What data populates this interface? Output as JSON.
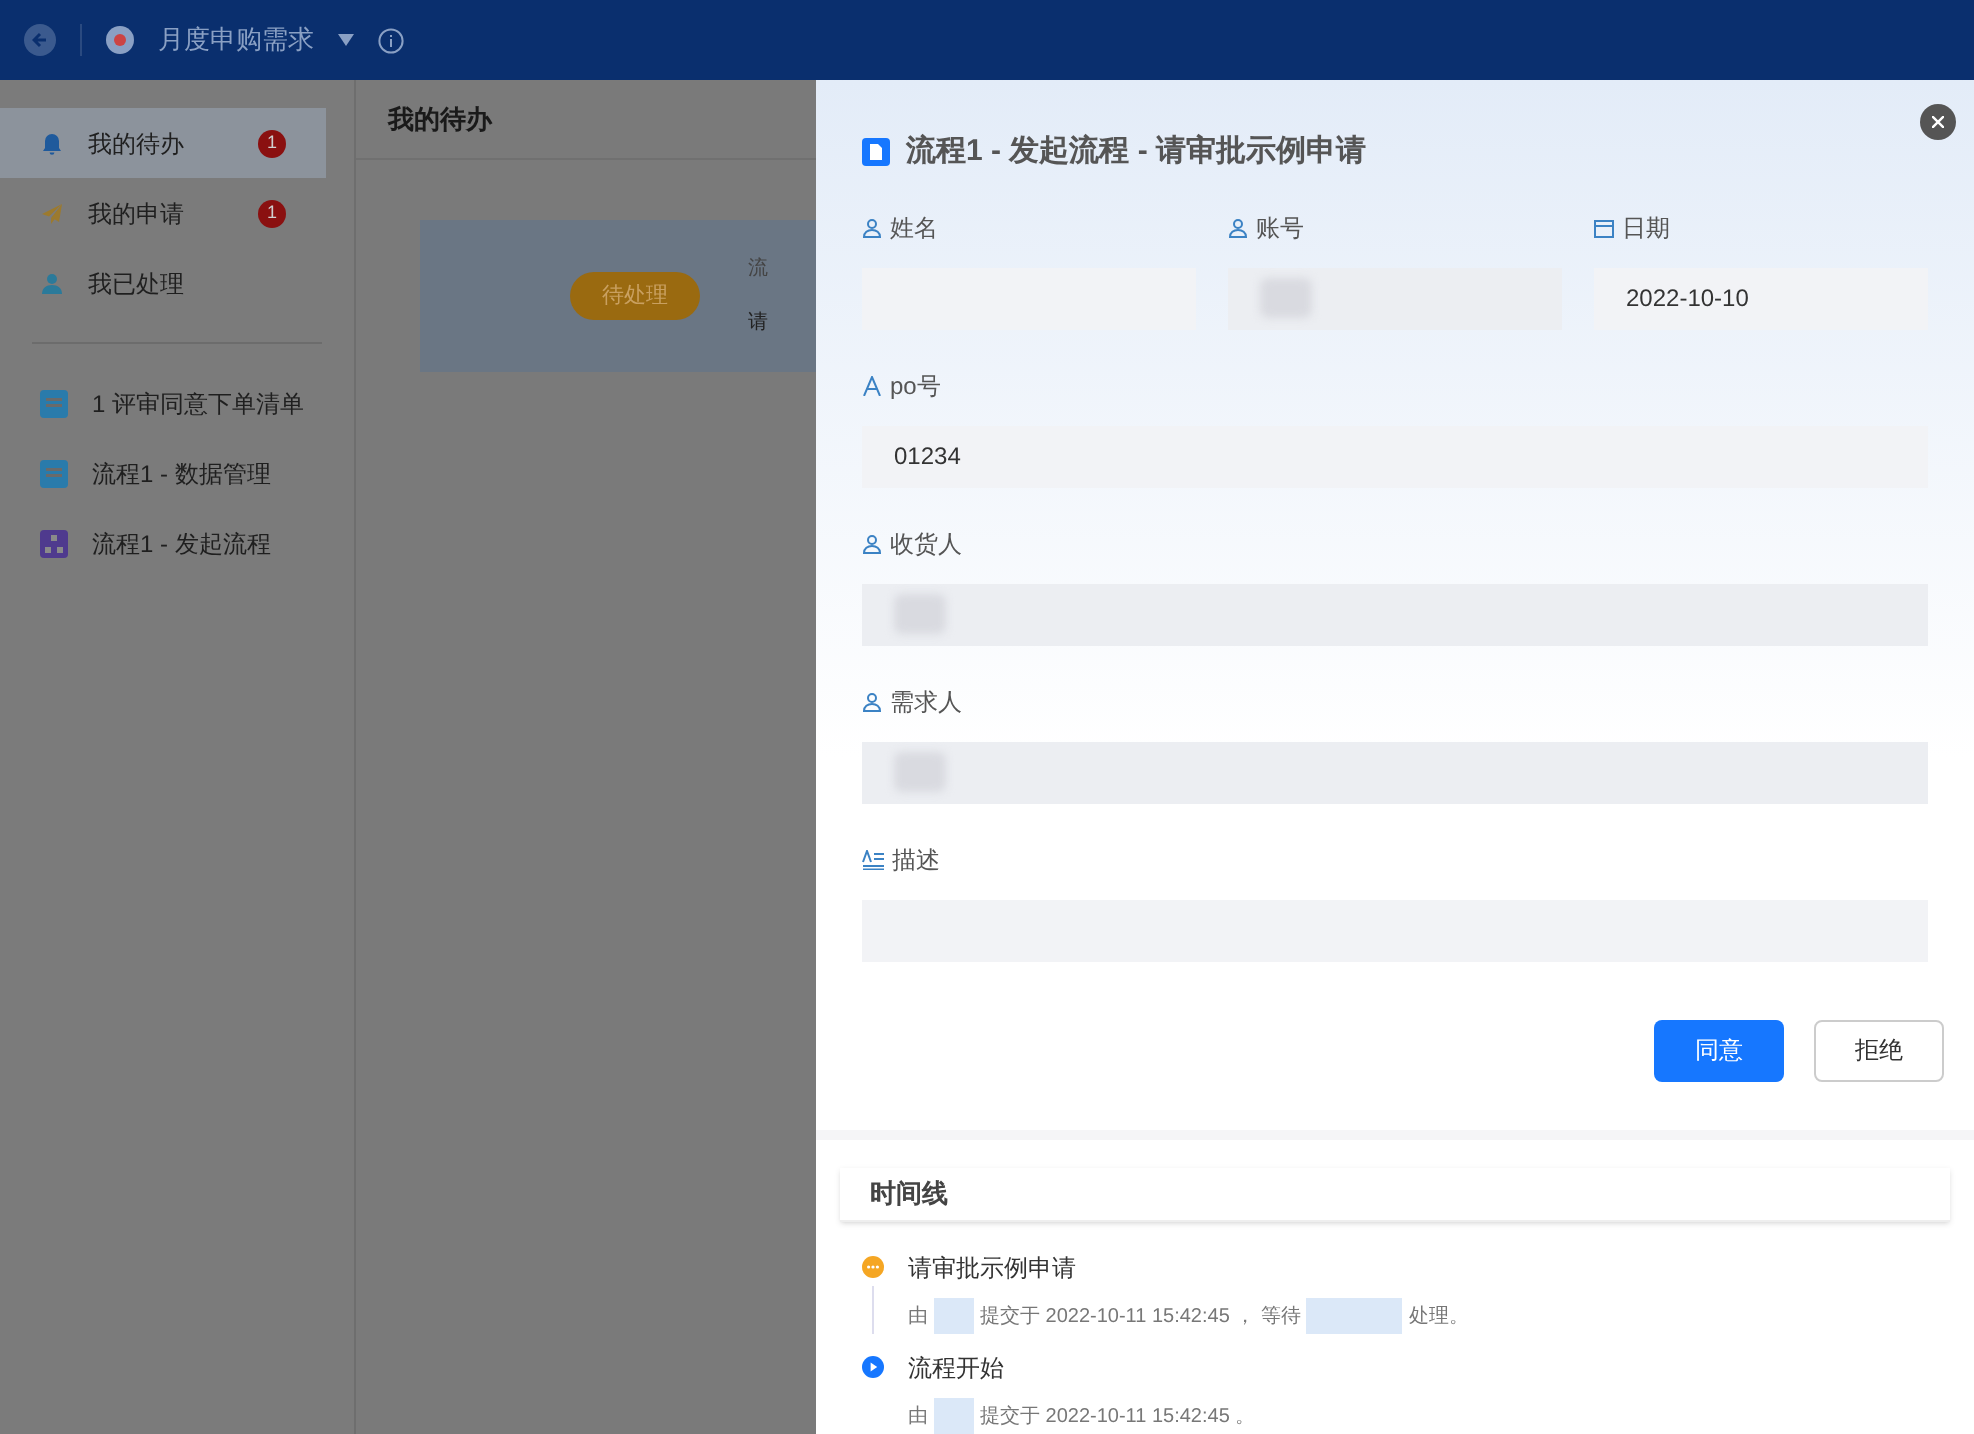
{
  "top_bar": {
    "app_title": "月度申购需求"
  },
  "sidebar": {
    "items": [
      {
        "label": "我的待办",
        "kind": "bell",
        "badge": "1",
        "selected": true
      },
      {
        "label": "我的申请",
        "kind": "send",
        "badge": "1",
        "selected": false
      },
      {
        "label": "我已处理",
        "kind": "user",
        "selected": false
      }
    ],
    "apps": [
      {
        "label": "1 评审同意下单清单",
        "kind": "doc"
      },
      {
        "label": "流程1 - 数据管理",
        "kind": "doc"
      },
      {
        "label": "流程1 - 发起流程",
        "kind": "flow"
      }
    ]
  },
  "main": {
    "title": "我的待办",
    "card": {
      "status": "待处理",
      "line_1": "流",
      "line_2": "请"
    }
  },
  "drawer": {
    "title": "流程1 - 发起流程 - 请审批示例申请",
    "field_rows": [
      [
        {
          "label": "姓名",
          "kind": "user",
          "blurred": false
        },
        {
          "label": "账号",
          "kind": "user",
          "blurred": true
        },
        {
          "label": "日期",
          "kind": "calendar",
          "value": "2022-10-10",
          "blurred": false
        }
      ],
      [
        {
          "label": "po号",
          "kind": "text",
          "value": "01234",
          "blurred": false
        }
      ],
      [
        {
          "label": "收货人",
          "kind": "user",
          "blurred": true
        }
      ],
      [
        {
          "label": "需求人",
          "kind": "user",
          "blurred": true
        }
      ],
      [
        {
          "label": "描述",
          "kind": "textarea",
          "blurred": false
        }
      ]
    ],
    "buttons": [
      {
        "label": "同意",
        "kind": "primary"
      },
      {
        "label": "拒绝",
        "kind": "default"
      }
    ],
    "timeline": {
      "title": "时间线",
      "events": [
        {
          "title": "请审批示例申请",
          "kind": "pending",
          "parts": [
            "由",
            "提交于 2022-10-11 15:42:45 ， 等待",
            "处理。"
          ]
        },
        {
          "title": "流程开始",
          "kind": "start",
          "parts": [
            "由",
            "提交于 2022-10-11 15:42:45 。"
          ]
        }
      ]
    }
  }
}
